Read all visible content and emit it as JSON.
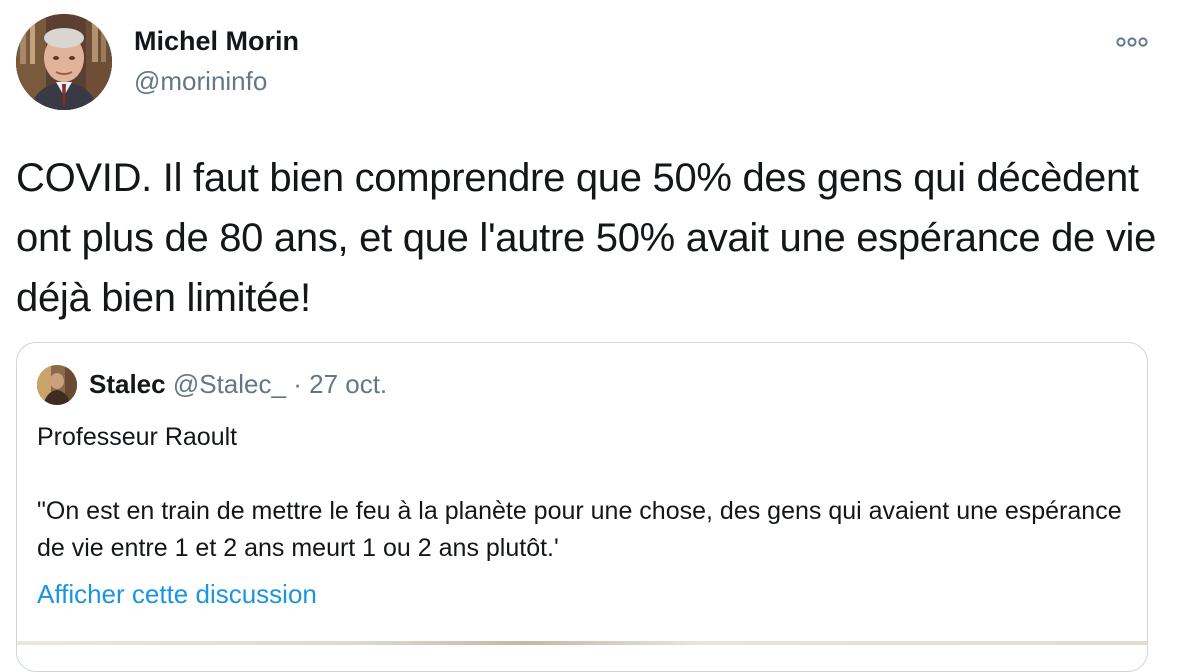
{
  "tweet": {
    "author": {
      "name": "Michel Morin",
      "handle": "@morininfo"
    },
    "more_icon": "more-horizontal-icon",
    "text": "COVID. Il faut bien comprendre que 50% des gens qui décèdent ont plus de 80 ans, et que l'autre 50% avait une espérance de vie déjà bien limitée!"
  },
  "quote": {
    "name": "Stalec",
    "handle": "@Stalec_",
    "separator": "·",
    "date": "27 oct.",
    "line1": "Professeur Raoult",
    "line2": "\"On  est en train de mettre le feu à la planète pour une chose, des gens qui avaient une espérance de vie entre 1 et 2 ans meurt  1 ou 2 ans plutôt.'",
    "link": "Afficher cette discussion"
  },
  "colors": {
    "text": "#14171a",
    "secondary": "#657786",
    "link": "#1b95e0",
    "border": "#ccd6dd"
  }
}
